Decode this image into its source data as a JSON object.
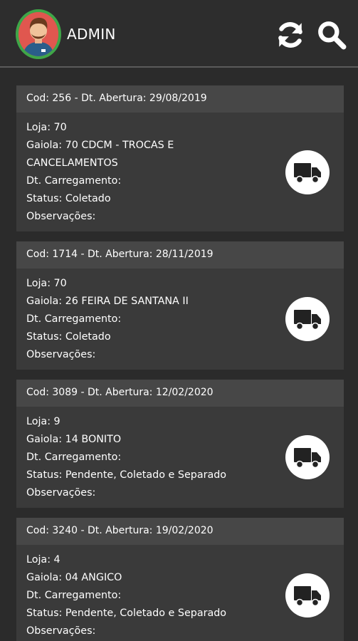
{
  "header": {
    "title": "ADMIN",
    "refresh_icon": "refresh-icon",
    "search_icon": "search-icon",
    "avatar_border_color": "#3fa648"
  },
  "cards": [
    {
      "head": "Cod: 256 - Dt. Abertura: 29/08/2019",
      "loja": "Loja: 70",
      "gaiola_lines": [
        "Gaiola: 70 CDCM - TROCAS E",
        "CANCELAMENTOS"
      ],
      "carregamento": "Dt. Carregamento:",
      "status": "Status: Coletado",
      "observacoes": "Observações:"
    },
    {
      "head": "Cod: 1714 - Dt. Abertura: 28/11/2019",
      "loja": "Loja: 70",
      "gaiola_lines": [
        "Gaiola: 26 FEIRA DE SANTANA II"
      ],
      "carregamento": "Dt. Carregamento:",
      "status": "Status: Coletado",
      "observacoes": "Observações:"
    },
    {
      "head": "Cod: 3089 - Dt. Abertura: 12/02/2020",
      "loja": "Loja: 9",
      "gaiola_lines": [
        "Gaiola: 14 BONITO"
      ],
      "carregamento": "Dt. Carregamento:",
      "status": "Status: Pendente, Coletado e Separado",
      "observacoes": "Observações:"
    },
    {
      "head": "Cod: 3240 - Dt. Abertura: 19/02/2020",
      "loja": "Loja: 4",
      "gaiola_lines": [
        "Gaiola: 04 ANGICO"
      ],
      "carregamento": "Dt. Carregamento:",
      "status": "Status: Pendente, Coletado e Separado",
      "observacoes": "Observações:"
    }
  ]
}
